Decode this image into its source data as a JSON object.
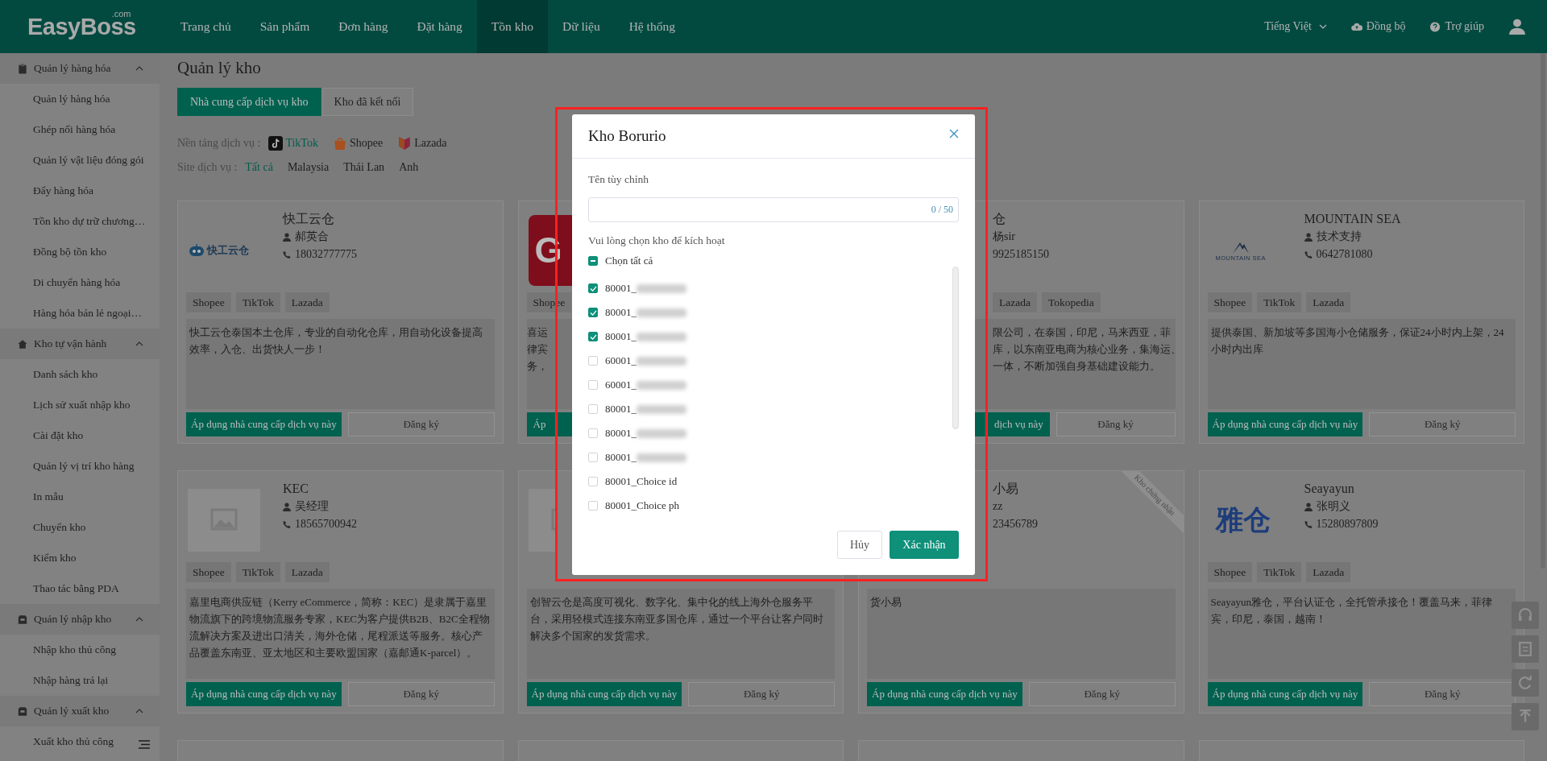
{
  "header": {
    "logo": "EasyBoss",
    "logo_suffix": ".com",
    "nav": [
      {
        "label": "Trang chủ",
        "selected": false
      },
      {
        "label": "Sản phẩm",
        "selected": false
      },
      {
        "label": "Đơn hàng",
        "selected": false
      },
      {
        "label": "Đặt hàng",
        "selected": false
      },
      {
        "label": "Tồn kho",
        "selected": true
      },
      {
        "label": "Dữ liệu",
        "selected": false
      },
      {
        "label": "Hệ thống",
        "selected": false
      }
    ],
    "language": "Tiếng Việt",
    "sync": "Đồng bộ",
    "help": "Trợ giúp"
  },
  "sidebar": {
    "groups": [
      {
        "label": "Quản lý hàng hóa",
        "expanded": true,
        "children": [
          {
            "label": "Quản lý hàng hóa"
          },
          {
            "label": "Ghép nối hàng hóa"
          },
          {
            "label": "Quản lý vật liệu đóng gói"
          },
          {
            "label": "Đẩy hàng hóa"
          },
          {
            "label": "Tồn kho dự trữ chương…"
          },
          {
            "label": "Đồng bộ tồn kho"
          },
          {
            "label": "Di chuyển hàng hóa"
          },
          {
            "label": "Hàng hóa bán lẻ ngoại…"
          }
        ]
      },
      {
        "label": "Kho tự vận hành",
        "expanded": true,
        "children": [
          {
            "label": "Danh sách kho"
          },
          {
            "label": "Lịch sử xuất nhập kho"
          },
          {
            "label": "Cài đặt kho"
          },
          {
            "label": "Quản lý vị trí kho hàng"
          },
          {
            "label": "In mẫu"
          },
          {
            "label": "Chuyển kho"
          },
          {
            "label": "Kiểm kho"
          },
          {
            "label": "Thao tác bằng PDA"
          }
        ]
      },
      {
        "label": "Quản lý nhập kho",
        "expanded": true,
        "children": [
          {
            "label": "Nhập kho thủ công"
          },
          {
            "label": "Nhập hàng trả lại"
          }
        ]
      },
      {
        "label": "Quản lý xuất kho",
        "expanded": true,
        "children": [
          {
            "label": "Xuất kho thủ công"
          }
        ]
      }
    ]
  },
  "page": {
    "title": "Quản lý kho",
    "tabs": [
      {
        "label": "Nhà cung cấp dịch vụ kho",
        "selected": true
      },
      {
        "label": "Kho đã kết nối",
        "selected": false
      }
    ],
    "platform_filter": {
      "label": "Nền tảng dịch vụ :",
      "options": [
        {
          "label": "TikTok",
          "selected": true
        },
        {
          "label": "Shopee",
          "selected": false
        },
        {
          "label": "Lazada",
          "selected": false
        }
      ]
    },
    "site_filter": {
      "label": "Site dịch vụ :",
      "options": [
        {
          "label": "Tất cả",
          "selected": true
        },
        {
          "label": "Malaysia",
          "selected": false
        },
        {
          "label": "Thái Lan",
          "selected": false
        },
        {
          "label": "Anh",
          "selected": false
        }
      ]
    }
  },
  "cards": [
    {
      "kind": "full",
      "logo": {
        "kind": "robot",
        "text": "快工云仓"
      },
      "name": "快工云仓",
      "contact": "郝英合",
      "phone": "18032777775",
      "tags": [
        "Shopee",
        "TikTok",
        "Lazada"
      ],
      "description": "快工云仓泰国本土仓库，专业的自动化仓库，用自动化设备提高效率，入仓、出货快人一步！",
      "apply": "Áp dụng nhà cung cấp dịch vụ này",
      "register": "Đăng ký"
    },
    {
      "kind": "left_part",
      "logo": {
        "kind": "block",
        "text": "G"
      },
      "tags": [
        "Shopee"
      ],
      "description_lines": [
        "喜运",
        "律宾",
        "务，"
      ],
      "apply": "Áp"
    },
    {
      "kind": "right_part",
      "name": "仓",
      "contact": "杨sir",
      "phone": "9925185150",
      "tags": [
        "Lazada",
        "Tokopedia"
      ],
      "description_lines": [
        "限公司，在泰国，印尼，马来西亚，菲",
        "库，以东南亚电商为核心业务，集海运、",
        "一体，不断加强自身基础建设能力。"
      ],
      "apply": "dịch vụ này",
      "register": "Đăng ký"
    },
    {
      "kind": "full",
      "logo": {
        "kind": "mountain",
        "text": "MOUNTAIN SEA"
      },
      "name": "MOUNTAIN SEA",
      "contact": "技术支持",
      "phone": "0642781080",
      "tags": [
        "Shopee",
        "TikTok",
        "Lazada"
      ],
      "description": "提供泰国、新加坡等多国海小仓储服务，保证24小时内上架，24小时内出库",
      "apply": "Áp dụng nhà cung cấp dịch vụ này",
      "register": "Đăng ký"
    },
    {
      "kind": "full",
      "logo": {
        "kind": "placeholder"
      },
      "name": "KEC",
      "contact": "吴经理",
      "phone": "18565700942",
      "tags": [
        "Shopee",
        "TikTok",
        "Lazada"
      ],
      "description": "嘉里电商供应链（Kerry eCommerce，简称：KEC）是隶属于嘉里物流旗下的跨境物流服务专家，KEC为客户提供B2B、B2C全程物流解决方案及进出口清关，海外仓储，尾程派送等服务。核心产品覆盖东南亚、亚太地区和主要欧盟国家（嘉邮通K-parcel）。",
      "apply": "Áp dụng nhà cung cấp dịch vụ này",
      "register": "Đăng ký"
    },
    {
      "kind": "lower_left",
      "logo": {
        "kind": "placeholder"
      },
      "description": "创智云仓是高度可视化、数字化、集中化的线上海外仓服务平台，采用轻模式连接东南亚多国仓库，通过一个平台让客户同时解决多个国家的发货需求。",
      "apply": "Áp dụng nhà cung cấp dịch vụ này",
      "register": "Đăng ký"
    },
    {
      "kind": "lower_right",
      "name": "小易",
      "contact": "zz",
      "phone": "23456789",
      "ribbon": "Kho chứng nhận",
      "description": "货小易",
      "apply": "Áp dụng nhà cung cấp dịch vụ này",
      "register": "Đăng ký"
    },
    {
      "kind": "full",
      "logo": {
        "kind": "text",
        "text": "雅仓"
      },
      "name": "Seayayun",
      "contact": "张明义",
      "phone": "15280897809",
      "tags": [
        "Shopee",
        "TikTok",
        "Lazada"
      ],
      "description": "Seayayun雅仓，平台认证仓，全托管承接仓！覆盖马来，菲律宾，印尼，泰国，越南！",
      "apply": "Áp dụng nhà cung cấp dịch vụ này",
      "register": "Đăng ký"
    },
    {
      "kind": "stub"
    },
    {
      "kind": "stub"
    },
    {
      "kind": "stub"
    },
    {
      "kind": "stub"
    }
  ],
  "modal": {
    "title": "Kho Borurio",
    "name_label": "Tên tùy chỉnh",
    "counter": "0 / 50",
    "select_label": "Vui lòng chọn kho để kích hoạt",
    "select_all": {
      "label": "Chọn tất cả",
      "indeterminate": true
    },
    "warehouses": [
      {
        "label": "80001_",
        "blurred": true,
        "checked": true
      },
      {
        "label": "80001_",
        "blurred": true,
        "checked": true
      },
      {
        "label": "80001_",
        "blurred": true,
        "checked": true
      },
      {
        "label": "60001_",
        "blurred": true,
        "checked": false
      },
      {
        "label": "60001_",
        "blurred": true,
        "checked": false
      },
      {
        "label": "80001_",
        "blurred": true,
        "checked": false
      },
      {
        "label": "80001_",
        "blurred": true,
        "checked": false
      },
      {
        "label": "80001_",
        "blurred": true,
        "checked": false
      },
      {
        "label": "80001_Choice id",
        "blurred": false,
        "checked": false
      },
      {
        "label": "80001_Choice ph",
        "blurred": false,
        "checked": false
      }
    ],
    "cancel": "Hủy",
    "confirm": "Xác nhận"
  }
}
